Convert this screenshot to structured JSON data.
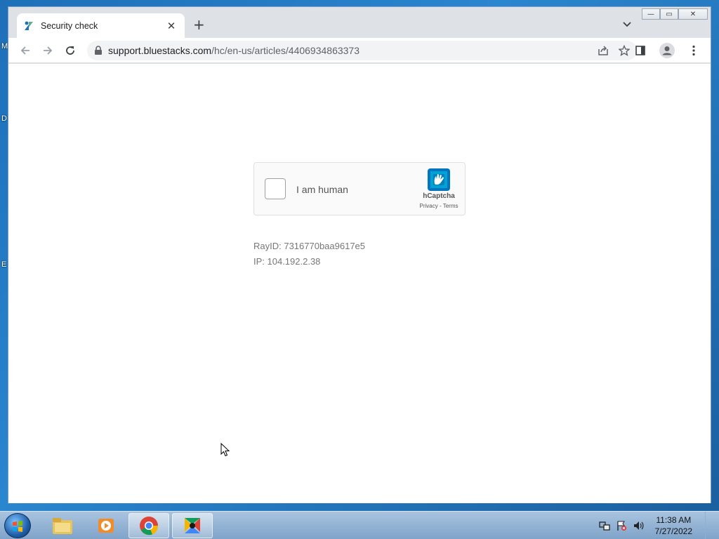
{
  "desktop": {
    "fragments": [
      "M",
      "D",
      "E"
    ]
  },
  "window_controls": {
    "minimize": "—",
    "restore": "▭",
    "close": "✕"
  },
  "tab": {
    "title": "Security check",
    "close": "✕"
  },
  "newtab": "+",
  "address": {
    "host": "support.bluestacks.com",
    "path": "/hc/en-us/articles/4406934863373"
  },
  "captcha": {
    "label": "I am human",
    "brand": "hCaptcha",
    "links": "Privacy - Terms",
    "checked": false
  },
  "info": {
    "ray": "RayID: 7316770baa9617e5",
    "ip": "IP: 104.192.2.38"
  },
  "taskbar": {
    "time": "11:38 AM",
    "date": "7/27/2022"
  },
  "colors": {
    "tab_bg": "#ffffff",
    "strip_bg": "#dee1e6",
    "taskbar": "#8fb0d4"
  }
}
